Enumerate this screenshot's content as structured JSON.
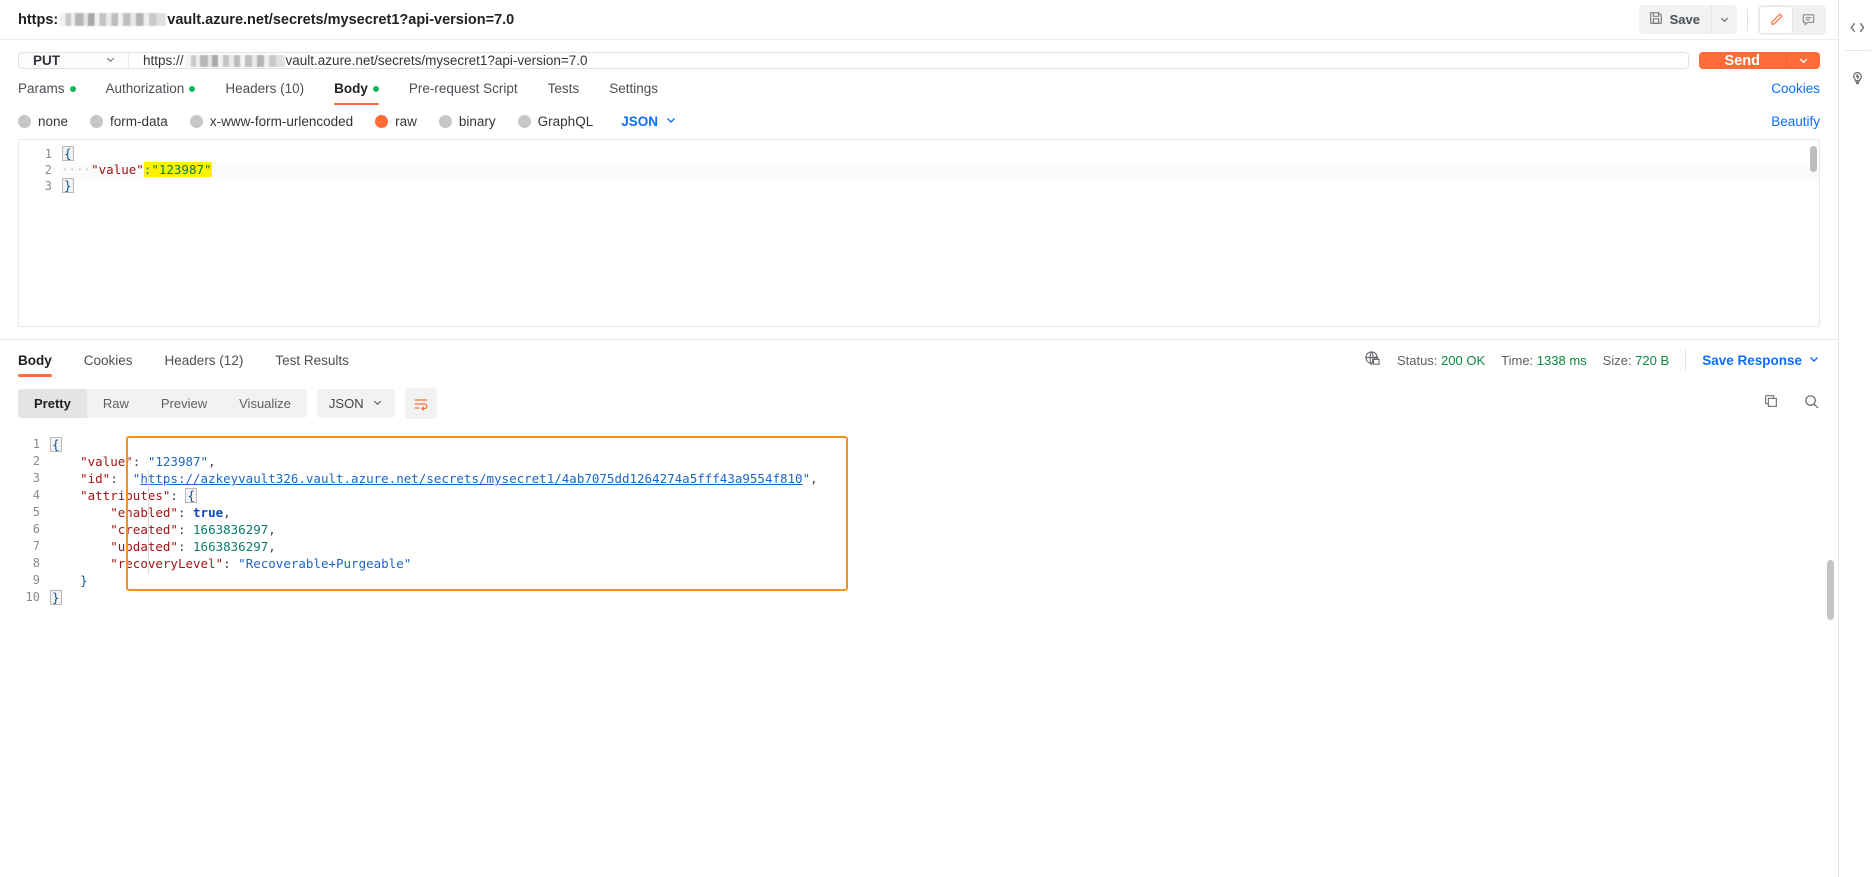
{
  "window": {
    "request_title_prefix": "https:",
    "request_title_suffix": "vault.azure.net/secrets/mysecret1?api-version=7.0",
    "redacted_label": "redacted-host"
  },
  "topbar": {
    "save_label": "Save",
    "save_icon": "floppy-disk-icon",
    "save_caret_icon": "chevron-down-icon",
    "edit_icon": "pencil-icon",
    "comment_icon": "comment-icon"
  },
  "right_rail": {
    "code_icon": "code-brackets-icon",
    "bulb_icon": "lightbulb-icon"
  },
  "url_bar": {
    "method": "PUT",
    "method_caret_icon": "chevron-down-icon",
    "url_prefix": "https://",
    "url_suffix": "vault.azure.net/secrets/mysecret1?api-version=7.0",
    "send_label": "Send",
    "send_caret_icon": "chevron-down-icon"
  },
  "request_tabs": {
    "items": [
      {
        "label": "Params",
        "dot": true,
        "active": false
      },
      {
        "label": "Authorization",
        "dot": true,
        "active": false
      },
      {
        "label": "Headers (10)",
        "dot": false,
        "active": false
      },
      {
        "label": "Body",
        "dot": true,
        "active": true
      },
      {
        "label": "Pre-request Script",
        "dot": false,
        "active": false
      },
      {
        "label": "Tests",
        "dot": false,
        "active": false
      },
      {
        "label": "Settings",
        "dot": false,
        "active": false
      }
    ],
    "cookies_link": "Cookies"
  },
  "body_type": {
    "options": [
      {
        "label": "none",
        "selected": false
      },
      {
        "label": "form-data",
        "selected": false
      },
      {
        "label": "x-www-form-urlencoded",
        "selected": false
      },
      {
        "label": "raw",
        "selected": true
      },
      {
        "label": "binary",
        "selected": false
      },
      {
        "label": "GraphQL",
        "selected": false
      }
    ],
    "format": "JSON",
    "format_caret_icon": "chevron-down-icon",
    "beautify_label": "Beautify"
  },
  "request_editor": {
    "line_numbers": [
      "1",
      "2",
      "3"
    ],
    "line1_brace": "{",
    "line2_indent": "····",
    "line2_key": "\"value\"",
    "line2_colon": ":",
    "line2_value": "\"123987\"",
    "line2_highlighted": ":\"123987\"",
    "line3_brace": "}",
    "highlight_color": "#fff200"
  },
  "response_tabs": {
    "items": [
      {
        "label": "Body",
        "active": true
      },
      {
        "label": "Cookies",
        "active": false
      },
      {
        "label": "Headers (12)",
        "active": false
      },
      {
        "label": "Test Results",
        "active": false
      }
    ]
  },
  "response_meta": {
    "network_icon": "globe-lock-icon",
    "status_label": "Status:",
    "status_value": "200 OK",
    "time_label": "Time:",
    "time_value": "1338 ms",
    "size_label": "Size:",
    "size_value": "720 B",
    "save_response_label": "Save Response",
    "save_response_caret_icon": "chevron-down-icon"
  },
  "response_toolbar": {
    "views": [
      {
        "label": "Pretty",
        "active": true
      },
      {
        "label": "Raw",
        "active": false
      },
      {
        "label": "Preview",
        "active": false
      },
      {
        "label": "Visualize",
        "active": false
      }
    ],
    "format": "JSON",
    "format_caret_icon": "chevron-down-icon",
    "wrap_icon": "word-wrap-icon",
    "copy_icon": "copy-icon",
    "search_icon": "search-icon"
  },
  "response_body": {
    "line_numbers": [
      "1",
      "2",
      "3",
      "4",
      "5",
      "6",
      "7",
      "8",
      "9",
      "10"
    ],
    "open_brace": "{",
    "close_brace": "}",
    "attributes_close_brace": "}",
    "entries": [
      {
        "key": "\"value\"",
        "value": "\"123987\"",
        "type": "string",
        "comma": ","
      },
      {
        "key": "\"id\"",
        "value": "\"https://azkeyvault326.vault.azure.net/secrets/mysecret1/4ab7075dd1264274a5fff43a9554f810\"",
        "type": "link",
        "comma": ","
      },
      {
        "key": "\"attributes\"",
        "value": "{",
        "type": "object",
        "comma": ""
      }
    ],
    "attributes": [
      {
        "key": "\"enabled\"",
        "value": "true",
        "type": "boolean",
        "comma": ","
      },
      {
        "key": "\"created\"",
        "value": "1663836297",
        "type": "number",
        "comma": ","
      },
      {
        "key": "\"updated\"",
        "value": "1663836297",
        "type": "number",
        "comma": ","
      },
      {
        "key": "\"recoveryLevel\"",
        "value": "\"Recoverable+Purgeable\"",
        "type": "string",
        "comma": ""
      }
    ],
    "link_text": "https://azkeyvault326.vault.azure.net/secrets/mysecret1/4ab7075dd1264274a5fff43a9554f810",
    "annotation_color": "#f2921d"
  },
  "colors": {
    "accent": "#ff6c37",
    "link": "#0d6efd",
    "success": "#13b55b",
    "status_ok": "#0a8a43",
    "annotation": "#f2921d",
    "highlight": "#fff200"
  }
}
